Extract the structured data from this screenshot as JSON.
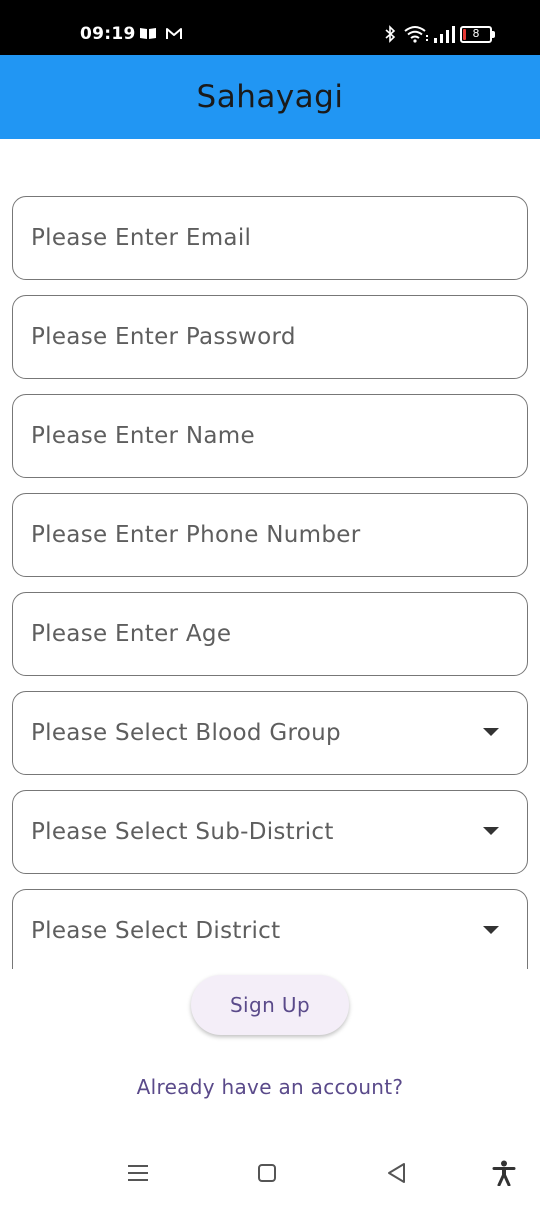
{
  "status_bar": {
    "time": "09:19",
    "battery_level": "8",
    "icons": [
      "book-icon",
      "mail-icon",
      "bluetooth-icon",
      "wifi-icon",
      "signal-icon",
      "battery-icon"
    ]
  },
  "app_bar": {
    "title": "Sahayagi",
    "background": "#2196f3"
  },
  "form": {
    "email_placeholder": "Please Enter Email",
    "password_placeholder": "Please Enter Password",
    "name_placeholder": "Please Enter Name",
    "phone_placeholder": "Please Enter Phone Number",
    "age_placeholder": "Please Enter Age",
    "blood_group_placeholder": "Please Select Blood Group",
    "sub_district_placeholder": "Please Select Sub-District",
    "district_placeholder": "Please Select District",
    "signup_label": "Sign Up",
    "login_link_label": "Already have an account?"
  },
  "nav_bar": {
    "icons": [
      "menu-icon",
      "home-icon",
      "back-icon",
      "accessibility-icon"
    ]
  }
}
